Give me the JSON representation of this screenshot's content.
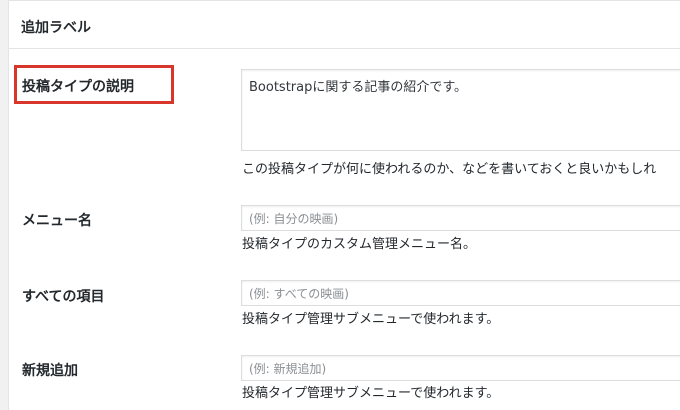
{
  "section": {
    "title": "追加ラベル"
  },
  "fields": {
    "description": {
      "label": "投稿タイプの説明",
      "value": "Bootstrapに関する記事の紹介です。",
      "help": "この投稿タイプが何に使われるのか、などを書いておくと良いかもしれ"
    },
    "menu_name": {
      "label": "メニュー名",
      "placeholder": "(例: 自分の映画)",
      "help": "投稿タイプのカスタム管理メニュー名。"
    },
    "all_items": {
      "label": "すべての項目",
      "placeholder": "(例: すべての映画)",
      "help": "投稿タイプ管理サブメニューで使われます。"
    },
    "add_new": {
      "label": "新規追加",
      "placeholder": "(例: 新規追加)",
      "help": "投稿タイプ管理サブメニューで使われます。"
    }
  },
  "colors": {
    "highlight": "#d9362b"
  }
}
